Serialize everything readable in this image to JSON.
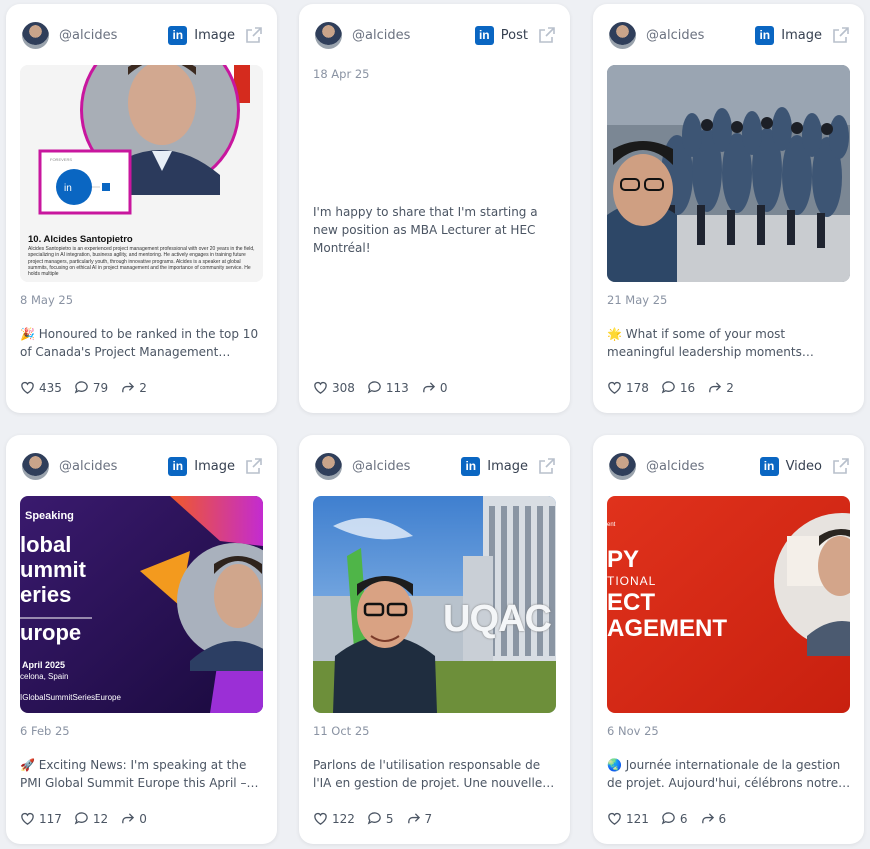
{
  "cards": [
    {
      "handle": "@alcides",
      "type": "Image",
      "date": "8 May 25",
      "caption": "🎉 Honoured to be ranked in the top 10 of Canada's Project Management…",
      "likes": "435",
      "comments": "79",
      "shares": "2",
      "media": {
        "kind": "ranking",
        "heading": "10. Alcides Santopietro",
        "body": "Alcides Santopietro is an experienced project management professional with over 20 years in the field, specializing in AI integration, business agility, and mentoring. He actively engages in training future project managers, particularly youth, through innovative programs. Alcides is a speaker at global summits, focusing on ethical AI in project management and the importance of community service. He holds multiple",
        "badge_small": "FOREVERS",
        "badge_in": "in"
      }
    },
    {
      "handle": "@alcides",
      "type": "Post",
      "date": "18 Apr 25",
      "caption": "I'm happy to share that I'm starting a new position as MBA Lecturer at HEC Montréal!",
      "likes": "308",
      "comments": "113",
      "shares": "0"
    },
    {
      "handle": "@alcides",
      "type": "Image",
      "date": "21 May 25",
      "caption": "🌟 What if some of your most meaningful leadership moments…",
      "likes": "178",
      "comments": "16",
      "shares": "2",
      "media": {
        "kind": "cadets"
      }
    },
    {
      "handle": "@alcides",
      "type": "Image",
      "date": "6 Feb 25",
      "caption": "🚀 Exciting News: I'm speaking at the PMI Global Summit Europe this April –…",
      "likes": "117",
      "comments": "12",
      "shares": "0",
      "media": {
        "kind": "summit",
        "line1": "Speaking",
        "line2": "lobal",
        "line3": "ummit",
        "line4": "eries",
        "line5": "urope",
        "date_line": "April 2025",
        "place_line": "celona, Spain",
        "hashtag": "IGlobalSummitSeriesEurope"
      }
    },
    {
      "handle": "@alcides",
      "type": "Image",
      "date": "11 Oct 25",
      "caption": "Parlons de l'utilisation responsable de l'IA en gestion de projet. Une nouvelle…",
      "likes": "122",
      "comments": "5",
      "shares": "7",
      "media": {
        "kind": "uqac",
        "sign": "UQAC"
      }
    },
    {
      "handle": "@alcides",
      "type": "Video",
      "date": "6 Nov 25",
      "caption": "🌏 Journée internationale de la gestion de projet. Aujourd'hui, célébrons notre…",
      "likes": "121",
      "comments": "6",
      "shares": "6",
      "media": {
        "kind": "pmday",
        "small": "ent",
        "l1": "PY",
        "l2": "TIONAL",
        "l3": "ECT",
        "l4": "AGEMENT"
      }
    }
  ]
}
